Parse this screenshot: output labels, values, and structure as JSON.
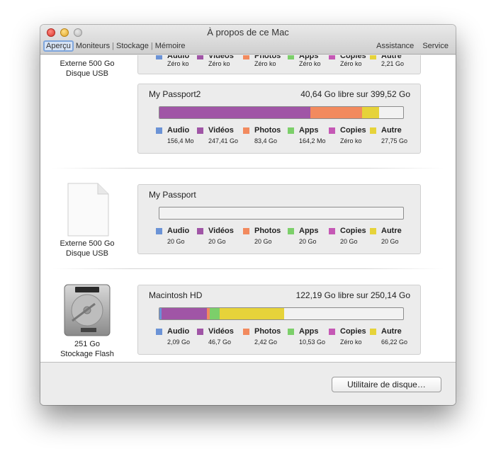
{
  "window": {
    "title": "À propos de ce Mac",
    "tabs": [
      "Aperçu",
      "Moniteurs",
      "Stockage",
      "Mémoire"
    ],
    "right_links": [
      "Assistance",
      "Service"
    ]
  },
  "legend_colors": {
    "audio": "#6b93d6",
    "videos": "#a055a6",
    "photos": "#f28a5e",
    "apps": "#7ccf6a",
    "copies": "#c558b5",
    "autre": "#e6d33a"
  },
  "devices": [
    {
      "label_line1": "Externe 500 Go",
      "label_line2": "Disque USB",
      "legend": [
        {
          "name": "Audio",
          "value": ""
        },
        {
          "name": "Vidéos",
          "value": "Zéro ko"
        },
        {
          "name": "Photos",
          "value": "Zéro ko"
        },
        {
          "name": "Apps",
          "value": "Zéro ko"
        },
        {
          "name": "Copies",
          "value": "Zéro ko"
        },
        {
          "name": "Autre",
          "value": "2,21 Go"
        }
      ],
      "first_value": "Zéro ko"
    },
    {
      "name": "My Passport2",
      "free": "40,64 Go libre sur 399,52 Go",
      "bar_fraction": [
        0,
        0.62,
        0.21,
        0,
        0,
        0.07
      ],
      "legend": [
        {
          "name": "Audio",
          "value": "156,4 Mo"
        },
        {
          "name": "Vidéos",
          "value": "247,41 Go"
        },
        {
          "name": "Photos",
          "value": "83,4 Go"
        },
        {
          "name": "Apps",
          "value": "164,2 Mo"
        },
        {
          "name": "Copies",
          "value": "Zéro ko"
        },
        {
          "name": "Autre",
          "value": "27,75 Go"
        }
      ]
    },
    {
      "name": "My Passport",
      "label_line1": "Externe 500 Go",
      "label_line2": "Disque USB",
      "legend": [
        {
          "name": "Audio",
          "value": "20 Go"
        },
        {
          "name": "Vidéos",
          "value": "20 Go"
        },
        {
          "name": "Photos",
          "value": "20 Go"
        },
        {
          "name": "Apps",
          "value": "20 Go"
        },
        {
          "name": "Copies",
          "value": "20 Go"
        },
        {
          "name": "Autre",
          "value": "20 Go"
        }
      ]
    },
    {
      "name": "Macintosh HD",
      "free": "122,19 Go libre sur 250,14 Go",
      "label_line1": "251 Go",
      "label_line2": "Stockage Flash",
      "bar_fraction": [
        0.008,
        0.187,
        0.01,
        0.042,
        0,
        0.265
      ],
      "legend": [
        {
          "name": "Audio",
          "value": "2,09 Go"
        },
        {
          "name": "Vidéos",
          "value": "46,7 Go"
        },
        {
          "name": "Photos",
          "value": "2,42 Go"
        },
        {
          "name": "Apps",
          "value": "10,53 Go"
        },
        {
          "name": "Copies",
          "value": "Zéro ko"
        },
        {
          "name": "Autre",
          "value": "66,22 Go"
        }
      ]
    }
  ],
  "footer": {
    "button_label": "Utilitaire de disque…"
  }
}
